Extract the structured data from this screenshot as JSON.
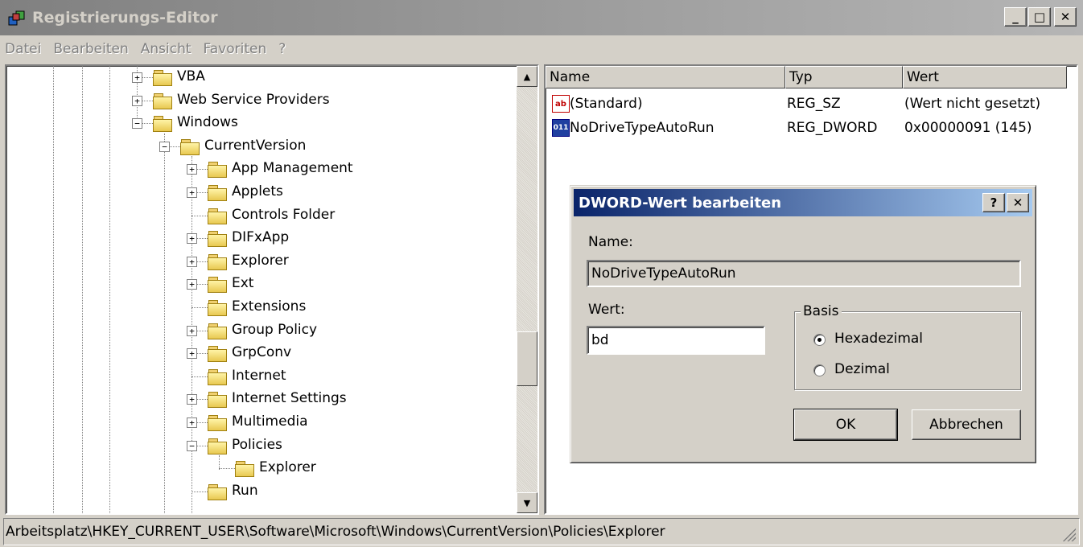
{
  "window": {
    "title": "Registrierungs-Editor",
    "minimize_glyph": "_",
    "maximize_glyph": "□",
    "close_glyph": "✕",
    "app_icon": "registry-icon"
  },
  "menu": [
    "Datei",
    "Bearbeiten",
    "Ansicht",
    "Favoriten",
    "?"
  ],
  "tree": {
    "items": [
      {
        "label": "VBA",
        "level": 0,
        "expander": "+"
      },
      {
        "label": "Web Service Providers",
        "level": 0,
        "expander": "+"
      },
      {
        "label": "Windows",
        "level": 0,
        "expander": "-"
      },
      {
        "label": "CurrentVersion",
        "level": 1,
        "expander": "-"
      },
      {
        "label": "App Management",
        "level": 2,
        "expander": "+"
      },
      {
        "label": "Applets",
        "level": 2,
        "expander": "+"
      },
      {
        "label": "Controls Folder",
        "level": 2,
        "expander": ""
      },
      {
        "label": "DIFxApp",
        "level": 2,
        "expander": "+"
      },
      {
        "label": "Explorer",
        "level": 2,
        "expander": "+"
      },
      {
        "label": "Ext",
        "level": 2,
        "expander": "+"
      },
      {
        "label": "Extensions",
        "level": 2,
        "expander": ""
      },
      {
        "label": "Group Policy",
        "level": 2,
        "expander": "+"
      },
      {
        "label": "GrpConv",
        "level": 2,
        "expander": "+"
      },
      {
        "label": "Internet",
        "level": 2,
        "expander": ""
      },
      {
        "label": "Internet Settings",
        "level": 2,
        "expander": "+"
      },
      {
        "label": "Multimedia",
        "level": 2,
        "expander": "+"
      },
      {
        "label": "Policies",
        "level": 2,
        "expander": "-"
      },
      {
        "label": "Explorer",
        "level": 3,
        "expander": "",
        "open": true
      },
      {
        "label": "Run",
        "level": 2,
        "expander": ""
      }
    ]
  },
  "list": {
    "headers": [
      "Name",
      "Typ",
      "Wert"
    ],
    "rows": [
      {
        "icon": "string-value-icon",
        "icon_text": "ab",
        "name": "(Standard)",
        "type": "REG_SZ",
        "value": "(Wert nicht gesetzt)"
      },
      {
        "icon": "dword-value-icon",
        "icon_text": "011",
        "name": "NoDriveTypeAutoRun",
        "type": "REG_DWORD",
        "value": "0x00000091 (145)"
      }
    ]
  },
  "dialog": {
    "title": "DWORD-Wert bearbeiten",
    "help_glyph": "?",
    "close_glyph": "✕",
    "name_label": "Name:",
    "name_value": "NoDriveTypeAutoRun",
    "value_label": "Wert:",
    "value_input": "bd",
    "basis_label": "Basis",
    "radio_hex": "Hexadezimal",
    "radio_dec": "Dezimal",
    "selected_basis": "Hexadezimal",
    "ok_label": "OK",
    "cancel_label": "Abbrechen"
  },
  "statusbar": {
    "path": "Arbeitsplatz\\HKEY_CURRENT_USER\\Software\\Microsoft\\Windows\\CurrentVersion\\Policies\\Explorer"
  }
}
